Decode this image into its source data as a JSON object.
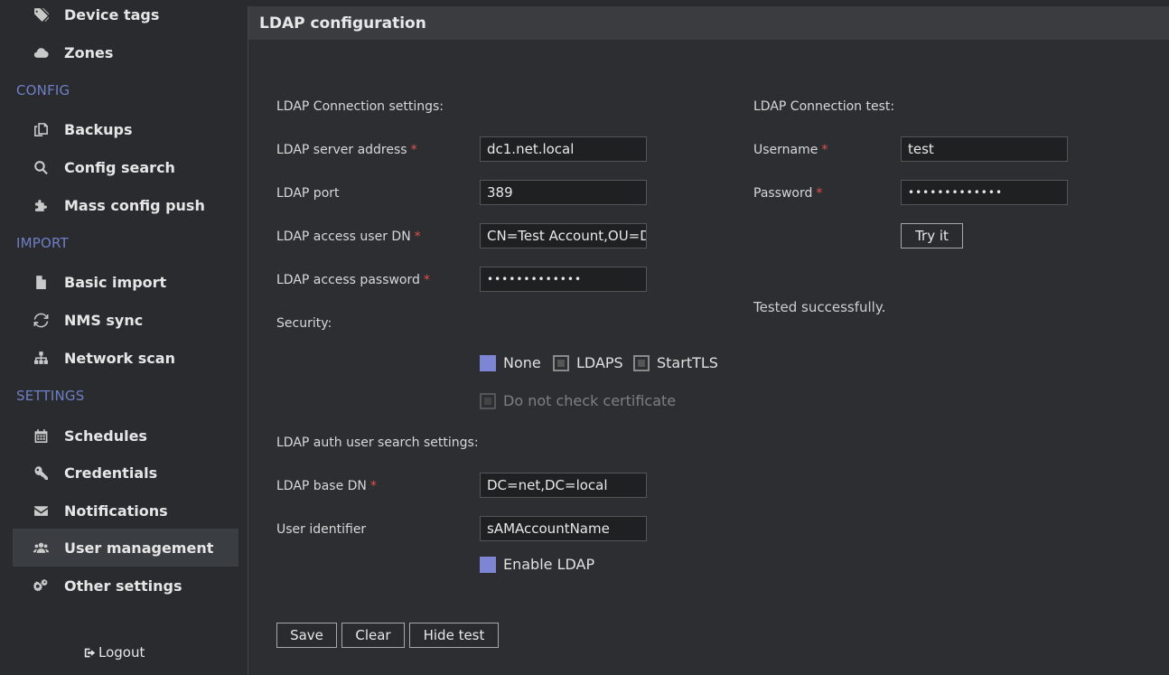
{
  "sidebar": {
    "items_top": [
      {
        "label": "Device tags",
        "icon": "tags-icon"
      },
      {
        "label": "Zones",
        "icon": "cloud-icon"
      }
    ],
    "sections": [
      {
        "label": "CONFIG",
        "items": [
          {
            "label": "Backups",
            "icon": "copy-icon"
          },
          {
            "label": "Config search",
            "icon": "search-icon"
          },
          {
            "label": "Mass config push",
            "icon": "puzzle-icon"
          }
        ]
      },
      {
        "label": "IMPORT",
        "items": [
          {
            "label": "Basic import",
            "icon": "file-icon"
          },
          {
            "label": "NMS sync",
            "icon": "sync-icon"
          },
          {
            "label": "Network scan",
            "icon": "sitemap-icon"
          }
        ]
      },
      {
        "label": "SETTINGS",
        "items": [
          {
            "label": "Schedules",
            "icon": "calendar-icon"
          },
          {
            "label": "Credentials",
            "icon": "key-icon"
          },
          {
            "label": "Notifications",
            "icon": "envelope-icon"
          },
          {
            "label": "User management",
            "icon": "users-icon"
          },
          {
            "label": "Other settings",
            "icon": "cogs-icon"
          }
        ]
      }
    ],
    "logout": "Logout"
  },
  "panel": {
    "title": "LDAP configuration",
    "connection_settings": {
      "heading": "LDAP Connection settings:",
      "server_label": "LDAP server address",
      "server_value": "dc1.net.local",
      "port_label": "LDAP port",
      "port_value": "389",
      "user_dn_label": "LDAP access user DN",
      "user_dn_value": "CN=Test Account,OU=Domain Users,DC=net,DC=local",
      "password_label": "LDAP access password",
      "password_value": "•••••••••••••",
      "security_label": "Security:",
      "security_options": [
        "None",
        "LDAPS",
        "StartTLS"
      ],
      "security_selected": "None",
      "no_check_cert": "Do not check certificate"
    },
    "search_settings": {
      "heading": "LDAP auth user search settings:",
      "base_dn_label": "LDAP base DN",
      "base_dn_value": "DC=net,DC=local",
      "user_id_label": "User identifier",
      "user_id_value": "sAMAccountName",
      "enable_label": "Enable LDAP"
    },
    "test": {
      "heading": "LDAP Connection test:",
      "username_label": "Username",
      "username_value": "test",
      "password_label": "Password",
      "password_value": "•••••••••••••",
      "try_button": "Try it",
      "status": "Tested successfully."
    },
    "buttons": {
      "save": "Save",
      "clear": "Clear",
      "hide_test": "Hide test"
    }
  },
  "colors": {
    "accent": "#7d86d4",
    "section_label": "#6f7fc4",
    "required": "#e0504a"
  }
}
